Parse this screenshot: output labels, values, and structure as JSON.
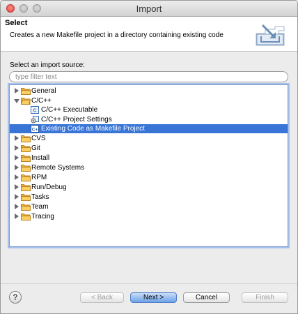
{
  "window": {
    "title": "Import"
  },
  "header": {
    "title": "Select",
    "description": "Creates a new Makefile project in a directory containing existing code"
  },
  "source_label": "Select an import source:",
  "filter": {
    "placeholder": "type filter text",
    "value": ""
  },
  "tree": {
    "general": "General",
    "cpp": "C/C++",
    "cpp_exec": "C/C++ Executable",
    "cpp_settings": "C/C++ Project Settings",
    "cpp_existing": "Existing Code as Makefile Project",
    "cvs": "CVS",
    "git": "Git",
    "install": "Install",
    "remote": "Remote Systems",
    "rpm": "RPM",
    "run_debug": "Run/Debug",
    "tasks": "Tasks",
    "team": "Team",
    "tracing": "Tracing"
  },
  "icons": {
    "c_file": "C",
    "cpp_existing": "C+"
  },
  "buttons": {
    "help": "?",
    "back": "< Back",
    "next": "Next >",
    "cancel": "Cancel",
    "finish": "Finish"
  },
  "colors": {
    "selection": "#3875d7",
    "default_button": "#6ea2e8",
    "folder": "#f0b43c"
  }
}
